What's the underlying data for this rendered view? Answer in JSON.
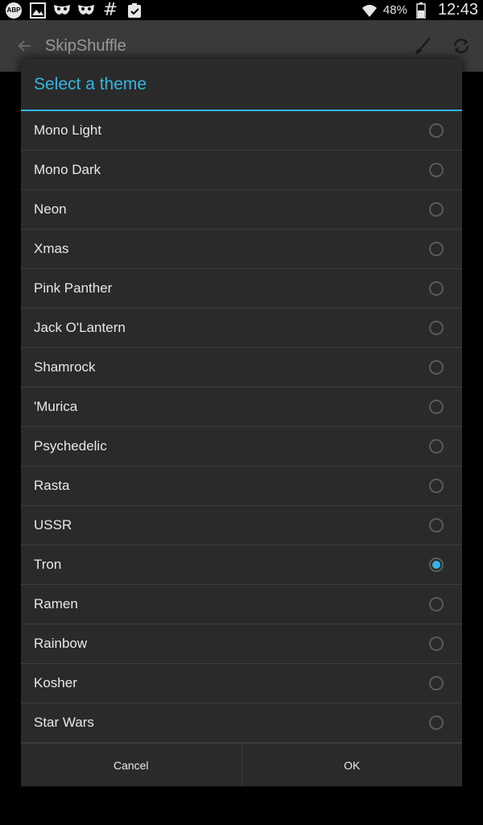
{
  "status_bar": {
    "icons_left": [
      "adblock-icon",
      "image-icon",
      "mask-icon",
      "mask-icon",
      "hash-icon",
      "clipboard-check-icon"
    ],
    "abp_text": "ABP",
    "hash_text": "#",
    "battery_percent": "48%",
    "time": "12:43"
  },
  "action_bar": {
    "title": "SkipShuffle",
    "icons": [
      "back-arrow-icon",
      "brush-icon",
      "sync-icon"
    ]
  },
  "dialog": {
    "title": "Select a theme",
    "accent_color": "#33b5e5",
    "themes": [
      {
        "label": "Mono Light",
        "selected": false
      },
      {
        "label": "Mono Dark",
        "selected": false
      },
      {
        "label": "Neon",
        "selected": false
      },
      {
        "label": "Xmas",
        "selected": false
      },
      {
        "label": "Pink Panther",
        "selected": false
      },
      {
        "label": "Jack O'Lantern",
        "selected": false
      },
      {
        "label": "Shamrock",
        "selected": false
      },
      {
        "label": "'Murica",
        "selected": false
      },
      {
        "label": "Psychedelic",
        "selected": false
      },
      {
        "label": "Rasta",
        "selected": false
      },
      {
        "label": "USSR",
        "selected": false
      },
      {
        "label": "Tron",
        "selected": true
      },
      {
        "label": "Ramen",
        "selected": false
      },
      {
        "label": "Rainbow",
        "selected": false
      },
      {
        "label": "Kosher",
        "selected": false
      },
      {
        "label": "Star Wars",
        "selected": false
      }
    ],
    "cancel_label": "Cancel",
    "ok_label": "OK"
  }
}
